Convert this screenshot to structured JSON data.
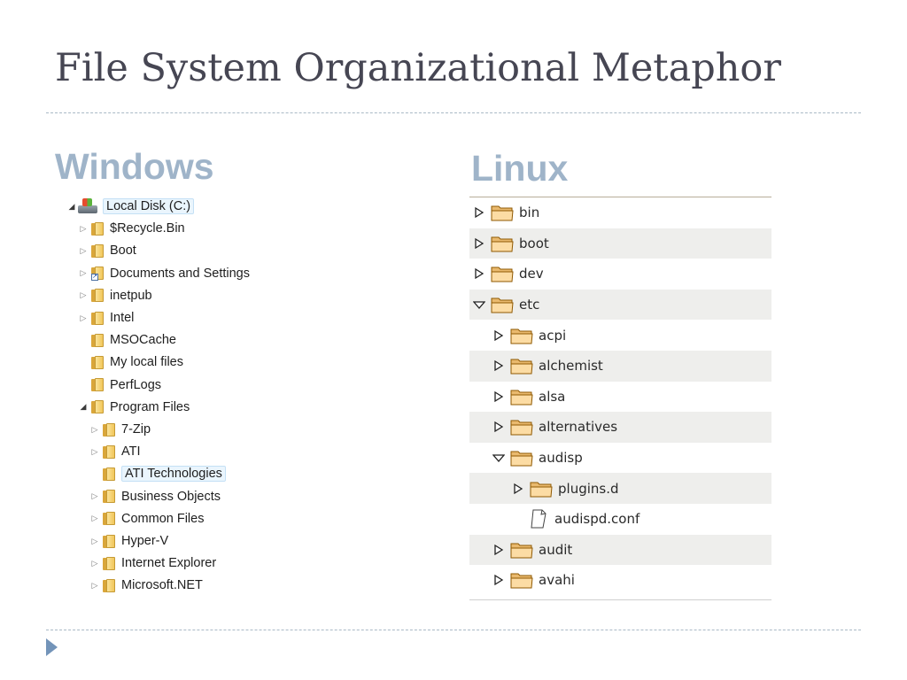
{
  "slide": {
    "title": "File System Organizational Metaphor",
    "windows_heading": "Windows",
    "linux_heading": "Linux"
  },
  "windows_tree": {
    "items": [
      {
        "label": "Local Disk (C:)",
        "level": 0,
        "expander": "expanded",
        "icon": "local-disk-icon",
        "selected": true
      },
      {
        "label": "$Recycle.Bin",
        "level": 1,
        "expander": "collapsed",
        "icon": "folder-icon"
      },
      {
        "label": "Boot",
        "level": 1,
        "expander": "collapsed",
        "icon": "folder-icon"
      },
      {
        "label": "Documents and Settings",
        "level": 1,
        "expander": "collapsed",
        "icon": "folder-shortcut-icon"
      },
      {
        "label": "inetpub",
        "level": 1,
        "expander": "collapsed",
        "icon": "folder-icon"
      },
      {
        "label": "Intel",
        "level": 1,
        "expander": "collapsed",
        "icon": "folder-icon"
      },
      {
        "label": "MSOCache",
        "level": 1,
        "expander": "none",
        "icon": "folder-icon"
      },
      {
        "label": "My local files",
        "level": 1,
        "expander": "none",
        "icon": "folder-icon"
      },
      {
        "label": "PerfLogs",
        "level": 1,
        "expander": "none",
        "icon": "folder-icon"
      },
      {
        "label": "Program Files",
        "level": 1,
        "expander": "expanded",
        "icon": "folder-icon"
      },
      {
        "label": "7-Zip",
        "level": 2,
        "expander": "collapsed",
        "icon": "folder-icon"
      },
      {
        "label": "ATI",
        "level": 2,
        "expander": "collapsed",
        "icon": "folder-icon"
      },
      {
        "label": "ATI Technologies",
        "level": 2,
        "expander": "none",
        "icon": "folder-icon",
        "selected": true
      },
      {
        "label": "Business Objects",
        "level": 2,
        "expander": "collapsed",
        "icon": "folder-icon"
      },
      {
        "label": "Common Files",
        "level": 2,
        "expander": "collapsed",
        "icon": "folder-icon"
      },
      {
        "label": "Hyper-V",
        "level": 2,
        "expander": "collapsed",
        "icon": "folder-icon"
      },
      {
        "label": "Internet Explorer",
        "level": 2,
        "expander": "collapsed",
        "icon": "folder-icon"
      },
      {
        "label": "Microsoft.NET",
        "level": 2,
        "expander": "collapsed",
        "icon": "folder-icon"
      }
    ]
  },
  "linux_tree": {
    "items": [
      {
        "label": "bin",
        "level": 0,
        "expander": "collapsed",
        "icon": "folder-icon"
      },
      {
        "label": "boot",
        "level": 0,
        "expander": "collapsed",
        "icon": "folder-icon"
      },
      {
        "label": "dev",
        "level": 0,
        "expander": "collapsed",
        "icon": "folder-icon"
      },
      {
        "label": "etc",
        "level": 0,
        "expander": "expanded",
        "icon": "folder-icon"
      },
      {
        "label": "acpi",
        "level": 1,
        "expander": "collapsed",
        "icon": "folder-icon"
      },
      {
        "label": "alchemist",
        "level": 1,
        "expander": "collapsed",
        "icon": "folder-icon"
      },
      {
        "label": "alsa",
        "level": 1,
        "expander": "collapsed",
        "icon": "folder-icon"
      },
      {
        "label": "alternatives",
        "level": 1,
        "expander": "collapsed",
        "icon": "folder-icon"
      },
      {
        "label": "audisp",
        "level": 1,
        "expander": "expanded",
        "icon": "folder-icon"
      },
      {
        "label": "plugins.d",
        "level": 2,
        "expander": "collapsed",
        "icon": "folder-icon"
      },
      {
        "label": "audispd.conf",
        "level": 2,
        "expander": "none",
        "icon": "file-icon"
      },
      {
        "label": "audit",
        "level": 1,
        "expander": "collapsed",
        "icon": "folder-icon"
      },
      {
        "label": "avahi",
        "level": 1,
        "expander": "collapsed",
        "icon": "folder-icon"
      }
    ]
  }
}
